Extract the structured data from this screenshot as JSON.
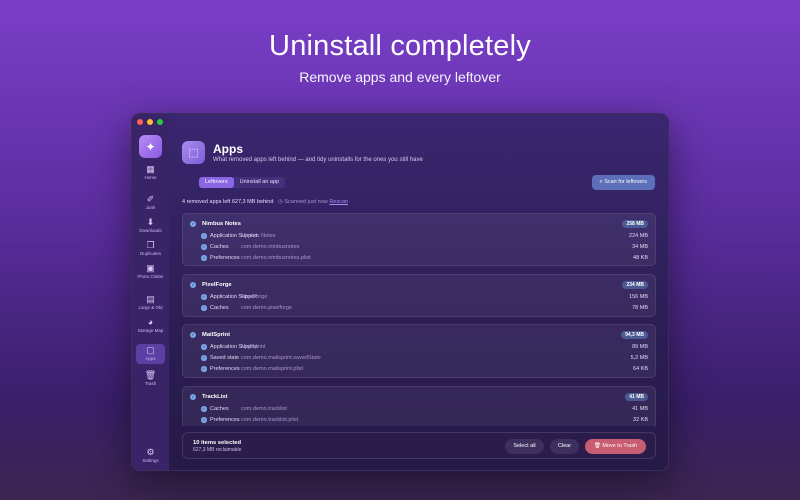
{
  "hero": {
    "title": "Uninstall completely",
    "subtitle": "Remove apps and every leftover"
  },
  "sidebar": {
    "items": [
      {
        "label": "Home",
        "icon": "home-icon"
      },
      {
        "label": "Junk",
        "icon": "broom-icon"
      },
      {
        "label": "Downloads",
        "icon": "download-icon"
      },
      {
        "label": "Duplicates",
        "icon": "duplicates-icon"
      },
      {
        "label": "Photo Clutter",
        "icon": "photo-icon"
      },
      {
        "label": "Large & Old",
        "icon": "file-icon"
      },
      {
        "label": "Storage Map",
        "icon": "pie-chart-icon"
      },
      {
        "label": "Apps",
        "icon": "apps-icon",
        "active": true
      },
      {
        "label": "Trash",
        "icon": "trash-icon"
      },
      {
        "label": "Settings",
        "icon": "gear-icon"
      }
    ]
  },
  "header": {
    "title": "Apps",
    "subtitle": "What removed apps left behind — and tidy uninstalls for the ones you still have"
  },
  "tabs": [
    "Leftovers",
    "Uninstall an app"
  ],
  "scan_button": "Scan for leftovers",
  "status": {
    "summary": "4 removed apps left 627,3 MB behind",
    "scanned": "Scanned just now",
    "rescan": "Rescan"
  },
  "apps": [
    {
      "name": "Nimbus Notes",
      "size": "258 MB",
      "items": [
        {
          "label": "Application Support",
          "path": "Nimbus Notes",
          "size": "224 MB"
        },
        {
          "label": "Caches",
          "path": "com.demo.nimbusnotes",
          "size": "34 MB"
        },
        {
          "label": "Preferences",
          "path": "com.demo.nimbusnotes.plist",
          "size": "48 KB"
        }
      ]
    },
    {
      "name": "PixelForge",
      "size": "234 MB",
      "items": [
        {
          "label": "Application Support",
          "path": "PixelForge",
          "size": "156 MB"
        },
        {
          "label": "Caches",
          "path": "com.demo.pixelforge",
          "size": "78 MB"
        }
      ]
    },
    {
      "name": "MailSprint",
      "size": "94,3 MB",
      "items": [
        {
          "label": "Application Support",
          "path": "MailSprint",
          "size": "89 MB"
        },
        {
          "label": "Saved state",
          "path": "com.demo.mailsprint.savedState",
          "size": "5,2 MB"
        },
        {
          "label": "Preferences",
          "path": "com.demo.mailsprint.plist",
          "size": "64 KB"
        }
      ]
    },
    {
      "name": "TrackList",
      "size": "41 MB",
      "items": [
        {
          "label": "Caches",
          "path": "com.demo.tracklist",
          "size": "41 MB"
        },
        {
          "label": "Preferences",
          "path": "com.demo.tracklist.plist",
          "size": "32 KB"
        }
      ]
    }
  ],
  "footer": {
    "selected": "10 items selected",
    "reclaimable": "627,3 MB reclaimable",
    "select_all": "Select all",
    "clear": "Clear",
    "move_to_trash": "Move to Trash"
  },
  "colors": {
    "accent": "#8a66e4",
    "danger": "#c85c70",
    "check": "#7aa6e8"
  }
}
